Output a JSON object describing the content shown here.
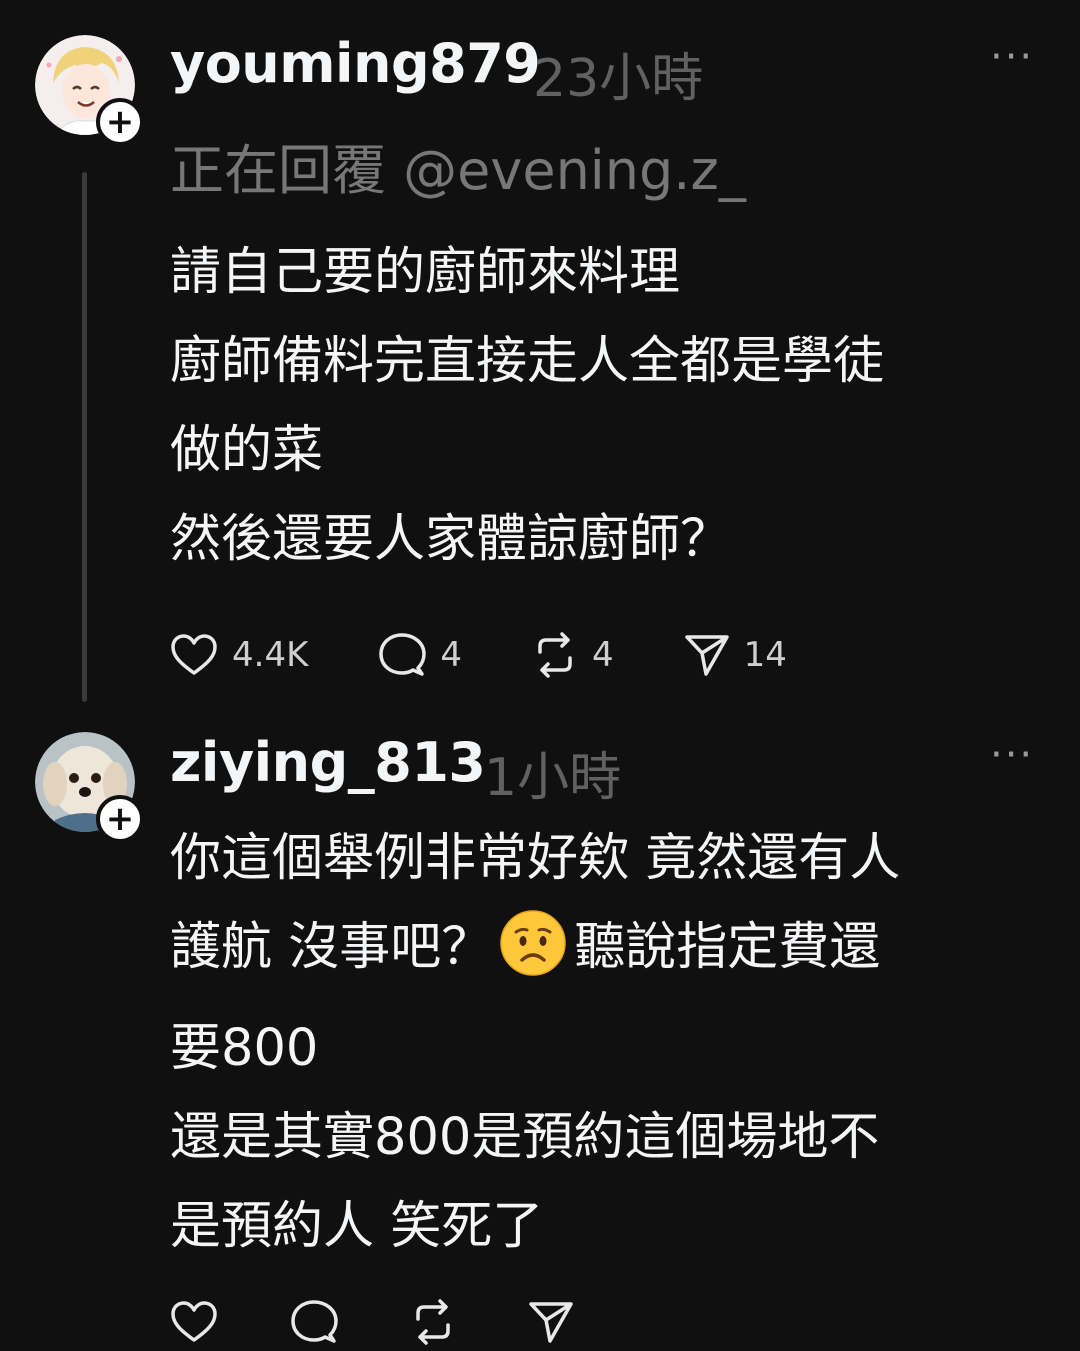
{
  "posts": [
    {
      "username": "youming879",
      "time": "23小時",
      "more": "···",
      "replying_prefix": "正在回覆",
      "replying_handle": "@evening.z_",
      "lines": [
        "請自己要的廚師來料理",
        "廚師備料完直接走人全都是學徒",
        "做的菜",
        "然後還要人家體諒廚師？"
      ],
      "likes": "4.4K",
      "comments": "4",
      "reposts": "4",
      "shares": "14"
    },
    {
      "username": "ziying_813",
      "time": "1小時",
      "more": "···",
      "line1": "你這個舉例非常好欸 竟然還有人",
      "line2a": "護航 沒事吧？",
      "line2b": "聽說指定費還",
      "line3": "要800",
      "line4": "還是其實800是預約這個場地不",
      "line5": "是預約人 笑死了"
    }
  ],
  "icons": {
    "like": "heart-icon",
    "comment": "comment-bubble-icon",
    "repost": "repost-icon",
    "share": "send-icon",
    "emoji": "worried-face-emoji"
  }
}
